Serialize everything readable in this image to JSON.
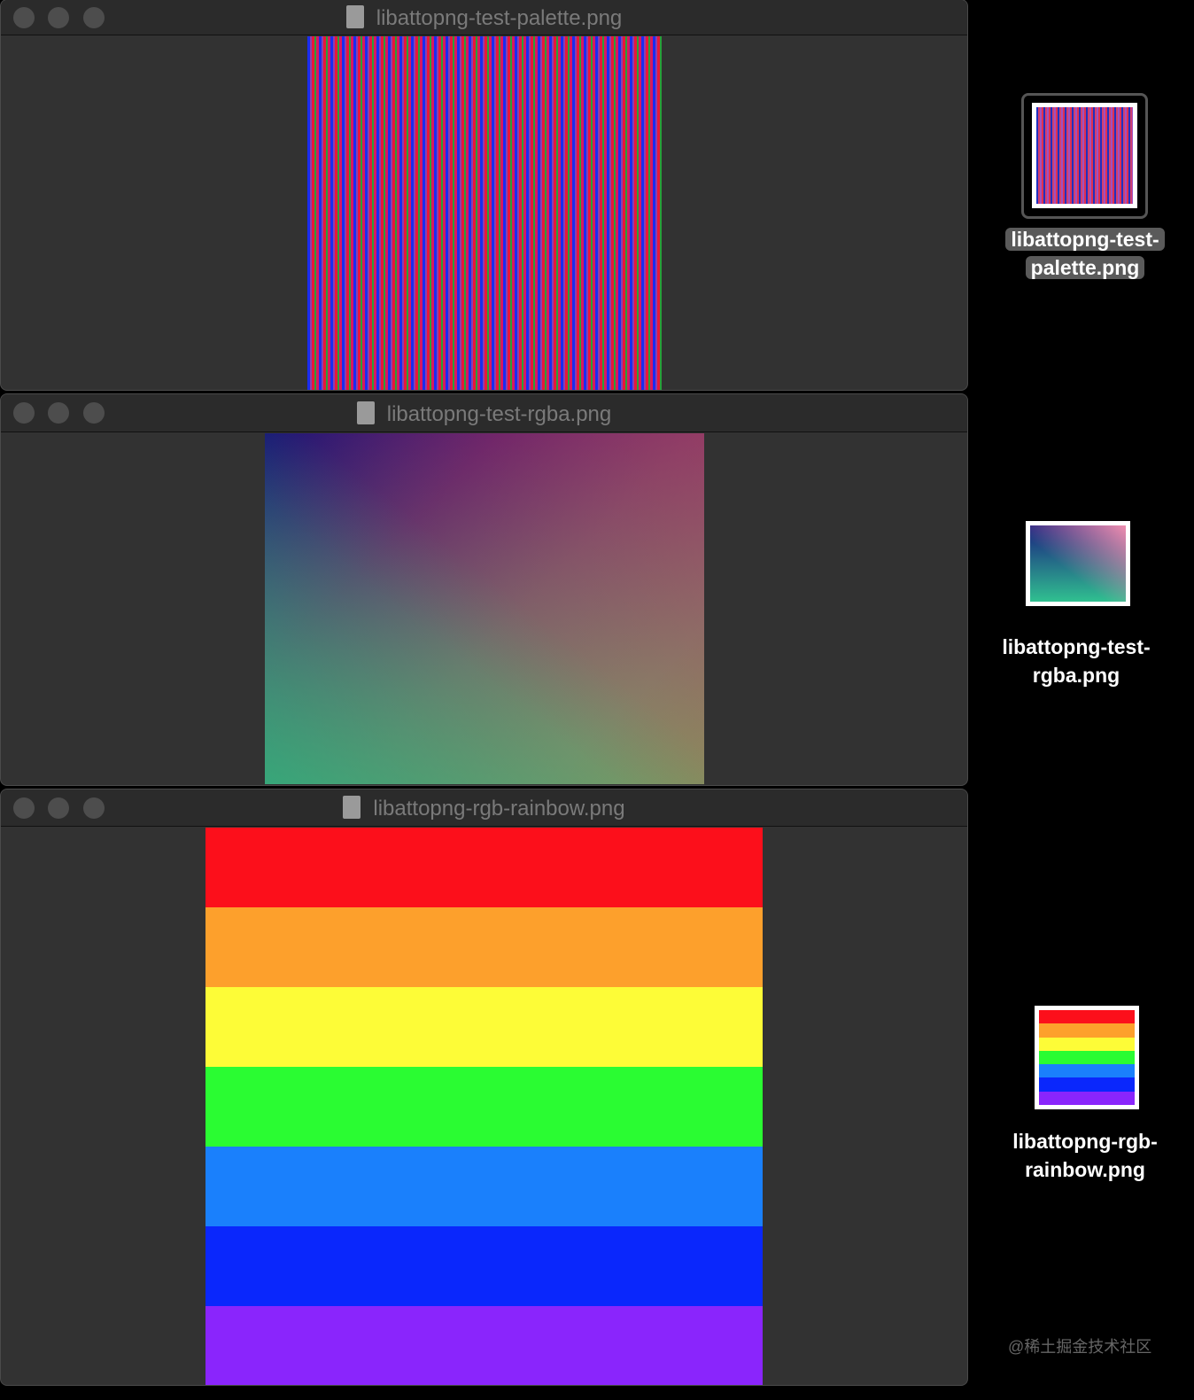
{
  "windows": [
    {
      "title": "libattopng-test-palette.png"
    },
    {
      "title": "libattopng-test-rgba.png"
    },
    {
      "title": "libattopng-rgb-rainbow.png"
    }
  ],
  "desktop_icons": [
    {
      "label_line1": "libattopng-test-",
      "label_line2": "palette.png",
      "selected": true
    },
    {
      "label_line1": "libattopng-test-",
      "label_line2": "rgba.png",
      "selected": false
    },
    {
      "label_line1": "libattopng-rgb-",
      "label_line2": "rainbow.png",
      "selected": false
    }
  ],
  "rainbow_colors": [
    "#fc0f1b",
    "#fda02c",
    "#fdfc37",
    "#2afc32",
    "#1a80fc",
    "#0a27fc",
    "#8a25fc"
  ],
  "watermark": "@稀土掘金技术社区"
}
